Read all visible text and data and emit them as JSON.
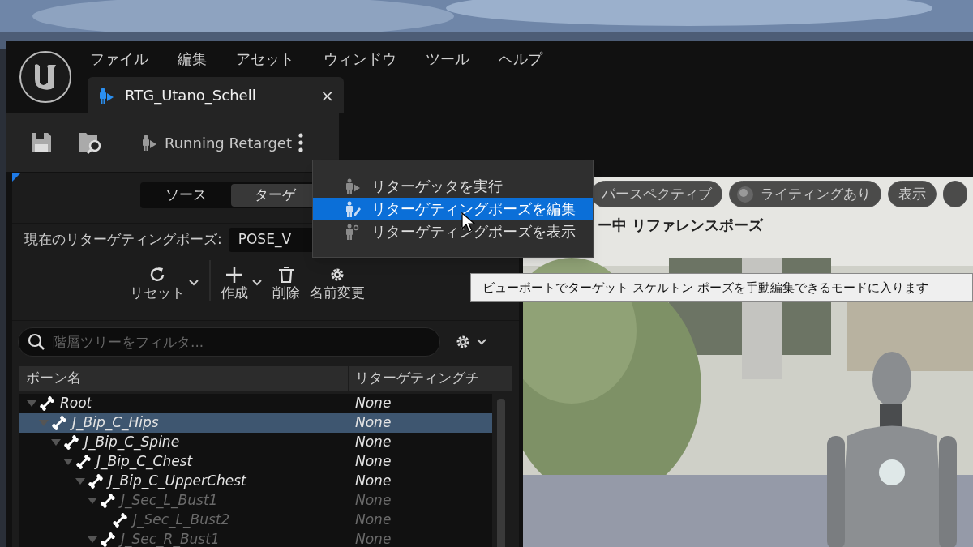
{
  "menu_bar": {
    "items": [
      "ファイル",
      "編集",
      "アセット",
      "ウィンドウ",
      "ツール",
      "ヘルプ"
    ]
  },
  "document_tab": {
    "title": "RTG_Utano_Schell",
    "close": "×"
  },
  "toolbar": {
    "run_button": "Running Retarget"
  },
  "left_panel": {
    "segments": [
      {
        "label": "ソース",
        "selected": false
      },
      {
        "label": "ターゲ",
        "selected": true
      }
    ],
    "pose_label": "現在のリターゲティングポーズ:",
    "pose_value": "POSE_V",
    "actions": [
      {
        "kind": "reset",
        "label": "リセット",
        "dropdown": true
      },
      {
        "kind": "create",
        "label": "作成",
        "dropdown": true
      },
      {
        "kind": "delete",
        "label": "削除",
        "dropdown": false
      },
      {
        "kind": "rename",
        "label": "名前変更",
        "dropdown": false
      }
    ],
    "search": {
      "placeholder": "階層ツリーをフィルタ..."
    },
    "columns": [
      "ボーン名",
      "リターゲティングチ"
    ],
    "bones": [
      {
        "name": "Root",
        "chain": "None",
        "dimmed": false,
        "selected": false,
        "expandable": true,
        "children": [
          {
            "name": "J_Bip_C_Hips",
            "chain": "None",
            "dimmed": false,
            "selected": true,
            "expandable": true,
            "children": [
              {
                "name": "J_Bip_C_Spine",
                "chain": "None",
                "dimmed": false,
                "selected": false,
                "expandable": true,
                "children": [
                  {
                    "name": "J_Bip_C_Chest",
                    "chain": "None",
                    "dimmed": false,
                    "selected": false,
                    "expandable": true,
                    "children": [
                      {
                        "name": "J_Bip_C_UpperChest",
                        "chain": "None",
                        "dimmed": false,
                        "selected": false,
                        "expandable": true,
                        "children": [
                          {
                            "name": "J_Sec_L_Bust1",
                            "chain": "None",
                            "dimmed": true,
                            "selected": false,
                            "expandable": true,
                            "children": [
                              {
                                "name": "J_Sec_L_Bust2",
                                "chain": "None",
                                "dimmed": true,
                                "selected": false,
                                "expandable": false
                              }
                            ]
                          },
                          {
                            "name": "J_Sec_R_Bust1",
                            "chain": "None",
                            "dimmed": true,
                            "selected": false,
                            "expandable": true
                          }
                        ]
                      }
                    ]
                  }
                ]
              }
            ]
          }
        ]
      }
    ]
  },
  "viewport": {
    "buttons": [
      {
        "kind": "view",
        "label": "パースペクティブ"
      },
      {
        "kind": "lighting",
        "label": "ライティングあり"
      },
      {
        "kind": "show",
        "label": "表示"
      },
      {
        "kind": "more"
      }
    ],
    "overlay_text": "ー中 リファレンスポーズ"
  },
  "context_menu": {
    "items": [
      {
        "kind": "run",
        "label": "リターゲッタを実行",
        "selected": false
      },
      {
        "kind": "edit",
        "label": "リターゲティングポーズを編集",
        "selected": true
      },
      {
        "kind": "show",
        "label": "リターゲティングポーズを表示",
        "selected": false
      }
    ]
  },
  "tooltip": {
    "text": "ビューポートでターゲット スケルトン ポーズを手動編集できるモードに入ります"
  }
}
